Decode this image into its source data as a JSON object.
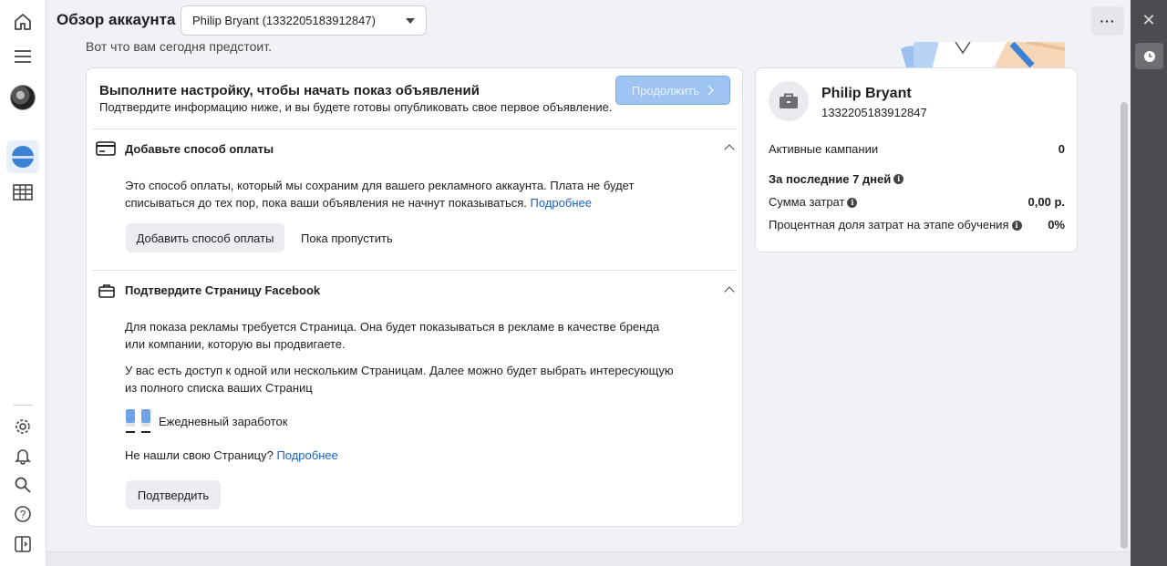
{
  "header": {
    "title": "Обзор аккаунта",
    "account_selector": "Philip Bryant (1332205183912847)",
    "more": "···"
  },
  "subtitle": "Вот что вам сегодня предстоит.",
  "setup": {
    "title": "Выполните настройку, чтобы начать показ объявлений",
    "description": "Подтвердите информацию ниже, и вы будете готовы опубликовать свое первое объявление.",
    "continue_label": "Продолжить",
    "payment": {
      "title": "Добавьте способ оплаты",
      "text_line1": "Это способ оплаты, который мы сохраним для вашего рекламного аккаунта. Плата не будет",
      "text_line2": "списываться до тех пор, пока ваши объявления не начнут показываться.",
      "link": "Подробнее",
      "add_button": "Добавить способ оплаты",
      "skip_button": "Пока пропустить"
    },
    "page": {
      "title": "Подтвердите Страницу Facebook",
      "text1_line1": "Для показа рекламы требуется Страница. Она будет показываться в рекламе в качестве бренда",
      "text1_line2": "или компании, которую вы продвигаете.",
      "text2_line1": "У вас есть доступ к одной или нескольким Страницам. Далее можно будет выбрать интересующую",
      "text2_line2": "из полного списка ваших Страниц",
      "page_name": "Ежедневный заработок",
      "not_found": "Не нашли свою Страницу?",
      "link": "Подробнее",
      "confirm_button": "Подтвердить"
    }
  },
  "account_info": {
    "name": "Philip Bryant",
    "id": "1332205183912847",
    "active_campaigns_label": "Активные кампании",
    "active_campaigns_value": "0",
    "period_label": "За последние 7 дней",
    "spend_label": "Сумма затрат",
    "spend_value": "0,00 р.",
    "learning_label": "Процентная доля затрат на этапе обучения",
    "learning_value": "0%"
  },
  "colors": {
    "link": "#1a62c4",
    "continue_button": "#9ec4f3",
    "active_nav": "#e7f0fb"
  }
}
